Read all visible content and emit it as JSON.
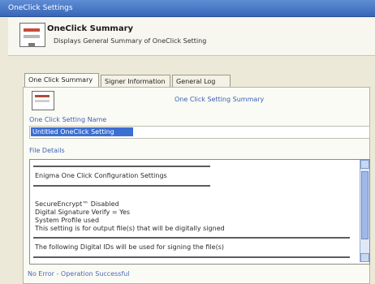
{
  "window": {
    "title": "OneClick Settings"
  },
  "header": {
    "title": "OneClick Summary",
    "subtitle": "Displays General Summary of OneClick Setting"
  },
  "tabs": [
    {
      "label": "One Click Summary"
    },
    {
      "label": "Signer Information"
    },
    {
      "label": "General Log"
    }
  ],
  "summary": {
    "label": "One Click Setting Summary"
  },
  "name_section": {
    "label": "One Click Setting Name",
    "value": "Untitled OneClick Setting"
  },
  "details_section": {
    "label": "File Details",
    "lines": [
      "Enigma One Click Configuration Settings",
      "SecureEncrypt™ Disabled",
      "Digital Signature Verify = Yes",
      "System Profile used",
      "This setting is for output file(s) that will be digitally signed",
      "The following Digital IDs will be used for signing the file(s)"
    ]
  },
  "status": {
    "text": "No Error - Operation Successful"
  }
}
